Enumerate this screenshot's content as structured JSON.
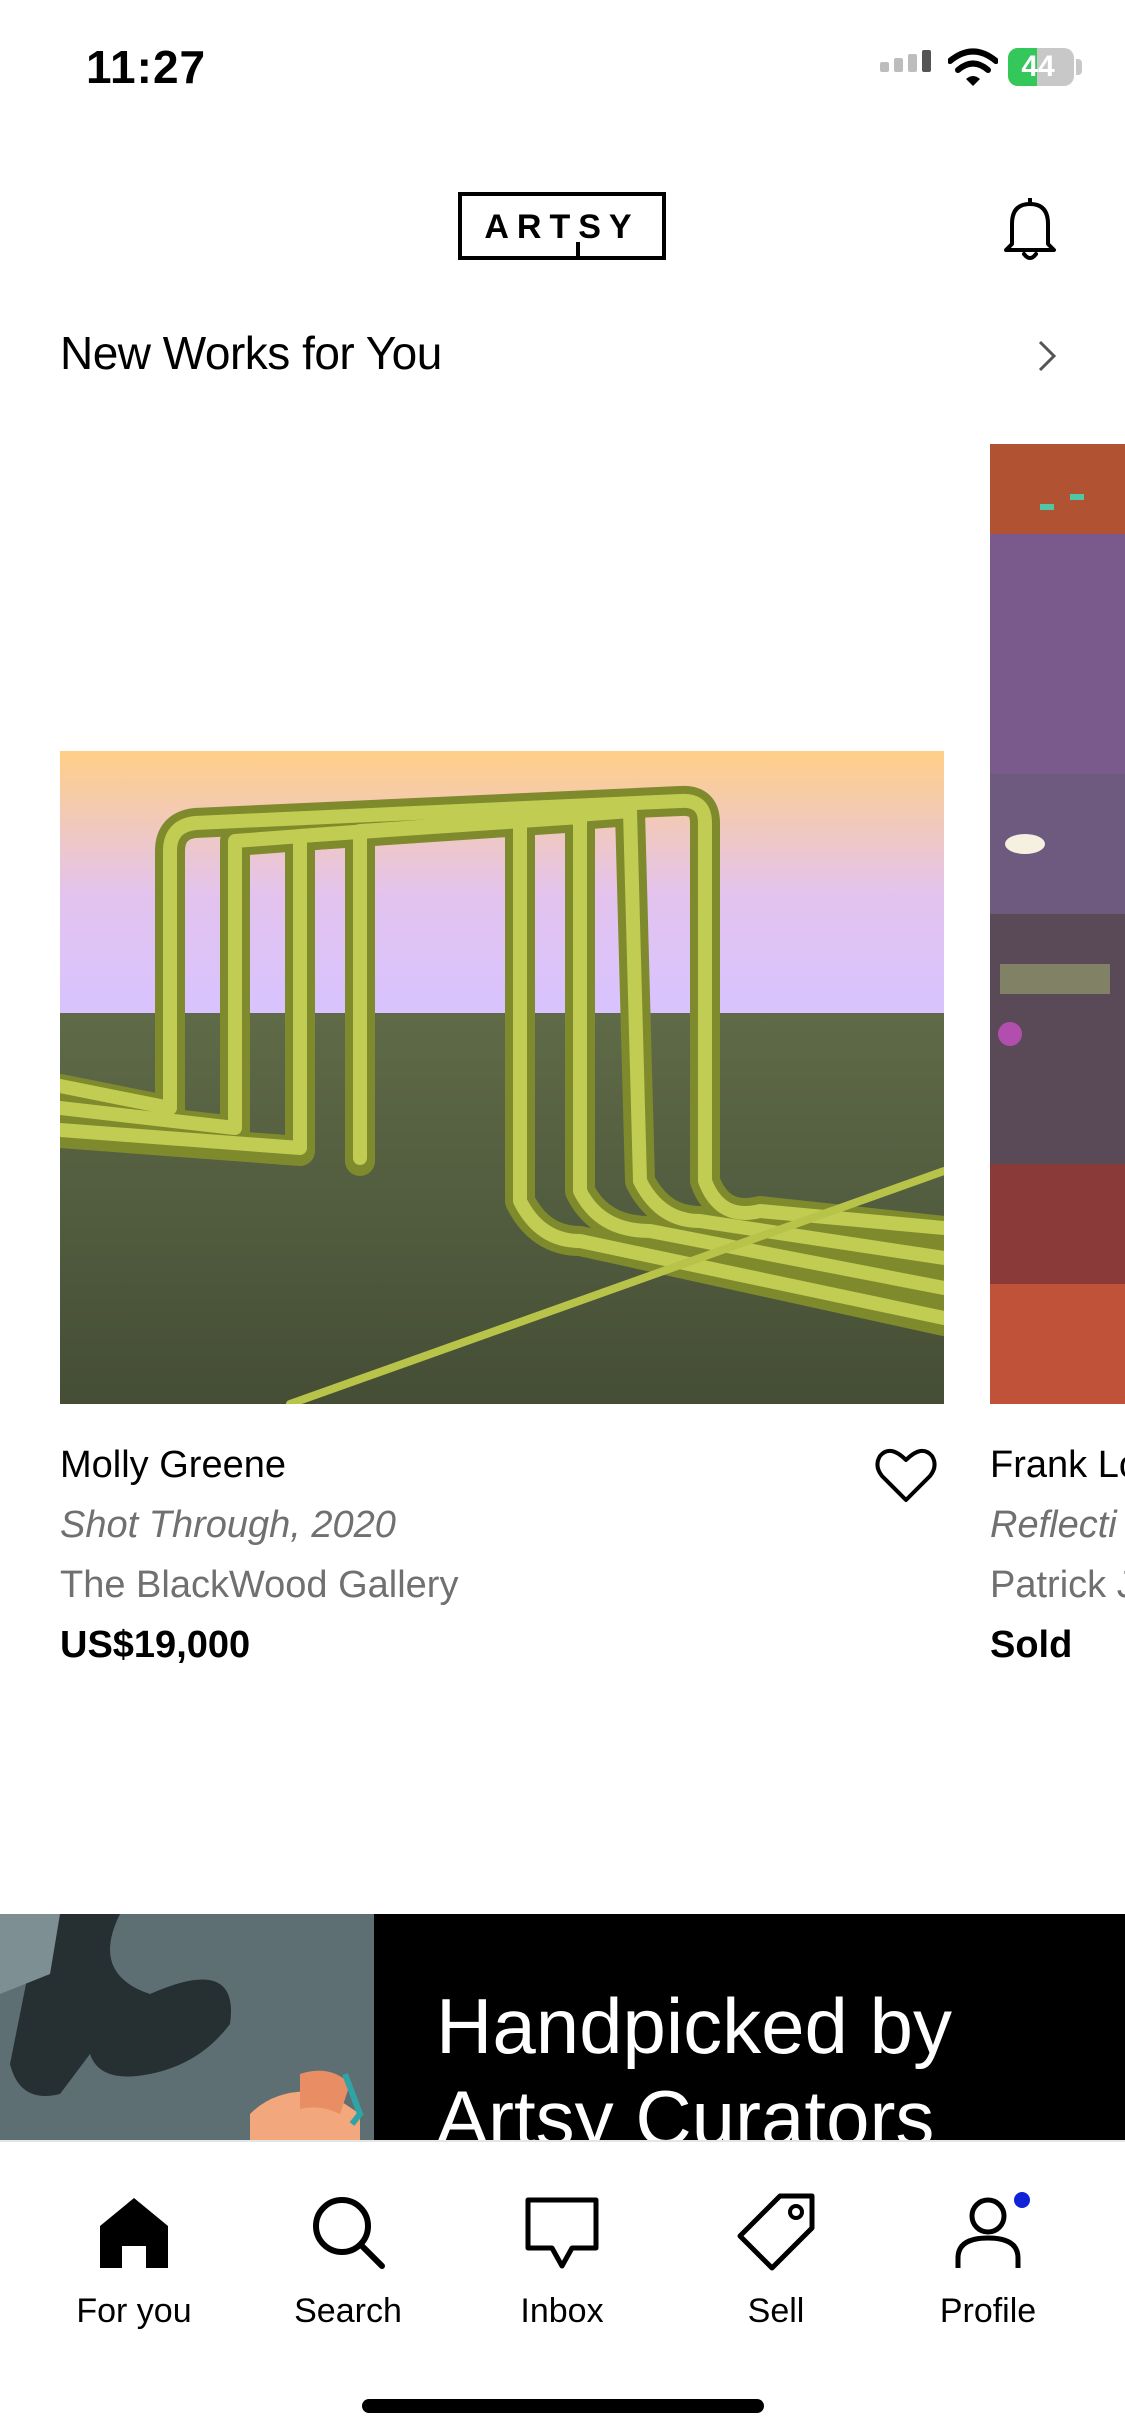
{
  "status_bar": {
    "time": "11:27",
    "battery": "44"
  },
  "header": {
    "logo": "ARTSY"
  },
  "section": {
    "title": "New Works for You"
  },
  "artworks": [
    {
      "artist": "Molly Greene",
      "title": "Shot Through, 2020",
      "gallery": "The BlackWood Gallery",
      "price": "US$19,000"
    },
    {
      "artist": "Frank Lo",
      "title": "Reflecti",
      "gallery": "Patrick J",
      "price": "Sold"
    }
  ],
  "promo": {
    "line1": "Handpicked by",
    "line2": "Artsy Curators"
  },
  "tabs": [
    {
      "label": "For you",
      "icon": "home-icon"
    },
    {
      "label": "Search",
      "icon": "search-icon"
    },
    {
      "label": "Inbox",
      "icon": "inbox-icon"
    },
    {
      "label": "Sell",
      "icon": "tag-icon"
    },
    {
      "label": "Profile",
      "icon": "profile-icon"
    }
  ],
  "colors": {
    "accent": "#1023d7",
    "battery": "#34c759"
  }
}
